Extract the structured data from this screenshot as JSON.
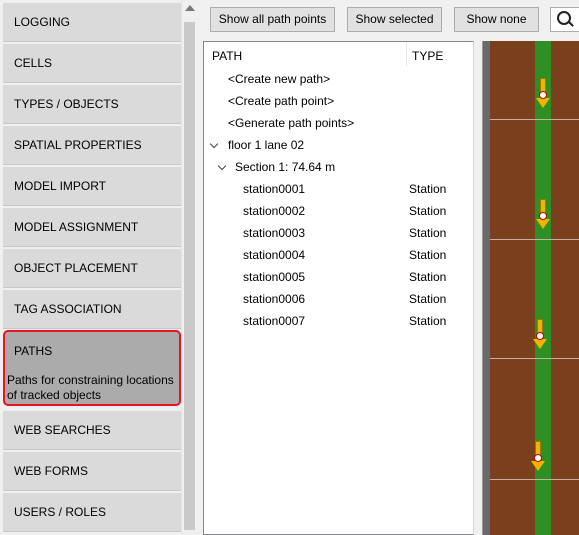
{
  "nav": {
    "items": [
      {
        "label": "LOGGING"
      },
      {
        "label": "CELLS"
      },
      {
        "label": "TYPES / OBJECTS"
      },
      {
        "label": "SPATIAL PROPERTIES"
      },
      {
        "label": "MODEL IMPORT"
      },
      {
        "label": "MODEL ASSIGNMENT"
      },
      {
        "label": "OBJECT PLACEMENT"
      },
      {
        "label": "TAG ASSOCIATION"
      },
      {
        "label": "PATHS",
        "description": "Paths for constraining locations of tracked objects",
        "active": true
      },
      {
        "label": "WEB SEARCHES"
      },
      {
        "label": "WEB FORMS"
      },
      {
        "label": "USERS / ROLES"
      }
    ]
  },
  "toolbar": {
    "show_all": "Show all path points",
    "show_selected": "Show selected",
    "show_none": "Show none",
    "search_icon": "search-icon"
  },
  "tree": {
    "columns": {
      "path": "PATH",
      "type": "TYPE"
    },
    "actions": [
      "<Create new path>",
      "<Create path point>",
      "<Generate path points>"
    ],
    "path": {
      "name": "floor 1 lane 02",
      "expanded": true,
      "section": {
        "label": "Section 1: 74.64 m",
        "expanded": true,
        "stations": [
          {
            "name": "station0001",
            "type": "Station"
          },
          {
            "name": "station0002",
            "type": "Station"
          },
          {
            "name": "station0003",
            "type": "Station"
          },
          {
            "name": "station0004",
            "type": "Station"
          },
          {
            "name": "station0005",
            "type": "Station"
          },
          {
            "name": "station0006",
            "type": "Station"
          },
          {
            "name": "station0007",
            "type": "Station"
          }
        ]
      }
    }
  },
  "map": {
    "floor_color": "#7a3f1c",
    "path_color": "#2e8f22",
    "marker_color": "#f0b400",
    "marker_icon": "station-arrow-icon"
  },
  "colors": {
    "highlight": "#e8141f",
    "active_bg": "#ababab",
    "nav_bg": "#dadada"
  }
}
